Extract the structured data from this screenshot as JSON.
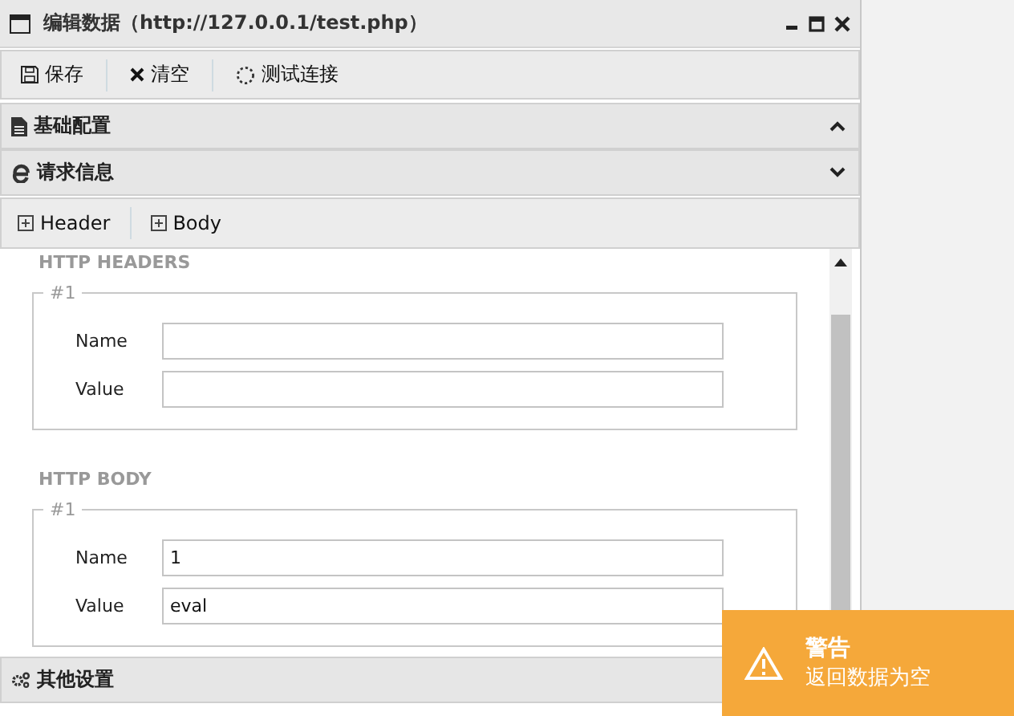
{
  "window": {
    "title": "编辑数据（http://127.0.0.1/test.php）"
  },
  "toolbar": [
    {
      "kind": "save",
      "label": "保存"
    },
    {
      "kind": "clear",
      "label": "清空"
    },
    {
      "kind": "test",
      "label": "测试连接"
    }
  ],
  "panels": [
    {
      "kind": "doc",
      "title": "基础配置",
      "expanded": false
    },
    {
      "kind": "ie",
      "title": "请求信息",
      "expanded": true
    }
  ],
  "tabs": [
    {
      "label": "Header"
    },
    {
      "label": "Body"
    }
  ],
  "sections": [
    {
      "heading": "HTTP HEADERS",
      "groups": [
        {
          "legend": "#1",
          "fields": [
            {
              "label": "Name"
            },
            {
              "label": "Value"
            }
          ]
        }
      ]
    },
    {
      "heading": "HTTP BODY",
      "groups": [
        {
          "legend": "#1",
          "fields": [
            {
              "label": "Name",
              "value": "1"
            },
            {
              "label": "Value",
              "value": "eval"
            }
          ]
        }
      ]
    }
  ],
  "footer_panel": {
    "title": "其他设置"
  },
  "toast": {
    "title": "警告",
    "message": "返回数据为空"
  }
}
